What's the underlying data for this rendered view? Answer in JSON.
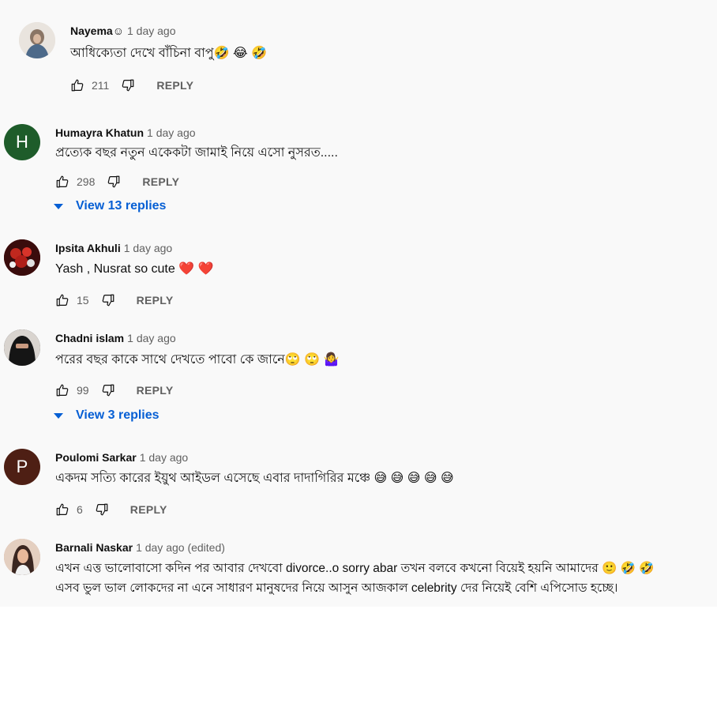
{
  "comments": [
    {
      "author": "Nayema☺",
      "time": "1 day ago",
      "text": "আধিক্যেতা দেখে বাঁচিনা বাপু🤣 😂 🤣",
      "likes": "211",
      "reply_label": "REPLY",
      "avatar_color": "#7a6a5e"
    },
    {
      "author": "Humayra Khatun",
      "time": "1 day ago",
      "text": "প্রত্যেক বছর নতুন একেকটা জামাই নিয়ে এসো নুসরত.....",
      "likes": "298",
      "reply_label": "REPLY",
      "avatar_letter": "H",
      "avatar_color": "#1e5c2a",
      "view_replies": "View 13 replies"
    },
    {
      "author": "Ipsita Akhuli",
      "time": "1 day ago",
      "text": "Yash , Nusrat so cute ❤️ ❤️",
      "likes": "15",
      "reply_label": "REPLY",
      "avatar_color": "#8b1a1a"
    },
    {
      "author": "Chadni islam",
      "time": "1 day ago",
      "text": "পরের বছর কাকে সাথে দেখতে পাবো কে জানে🙄 🙄 🤷‍♀️",
      "likes": "99",
      "reply_label": "REPLY",
      "avatar_color": "#2b2b2b",
      "view_replies": "View 3 replies"
    },
    {
      "author": "Poulomi Sarkar",
      "time": "1 day ago",
      "text": "একদম সত্যি কারের ইয়ুথ আইডল এসেছে এবার দাদাগিরির মঞ্চে 😅 😅 😅 😅 😅",
      "likes": "6",
      "reply_label": "REPLY",
      "avatar_letter": "P",
      "avatar_color": "#4e1f14"
    },
    {
      "author": "Barnali Naskar",
      "time": "1 day ago (edited)",
      "text_line1": "এখন এত্ত ভালোবাসো কদিন পর আবার দেখবো divorce..o sorry abar তখন বলবে কখনো বিয়েই হয়নি আমাদের 🙂 🤣 🤣",
      "text_line2": "এসব ভুল ভাল লোকদের না এনে সাধারণ মানুষদের নিয়ে আসুন আজকাল celebrity দের নিয়েই বেশি এপিসোড হচ্ছে।",
      "avatar_color": "#c8a08a"
    }
  ],
  "colors": {
    "background": "#f9f9f9",
    "link_blue": "#065fd4",
    "secondary_text": "#606060"
  },
  "icons": [
    "thumbs-up-icon",
    "thumbs-down-icon",
    "caret-down-icon"
  ]
}
